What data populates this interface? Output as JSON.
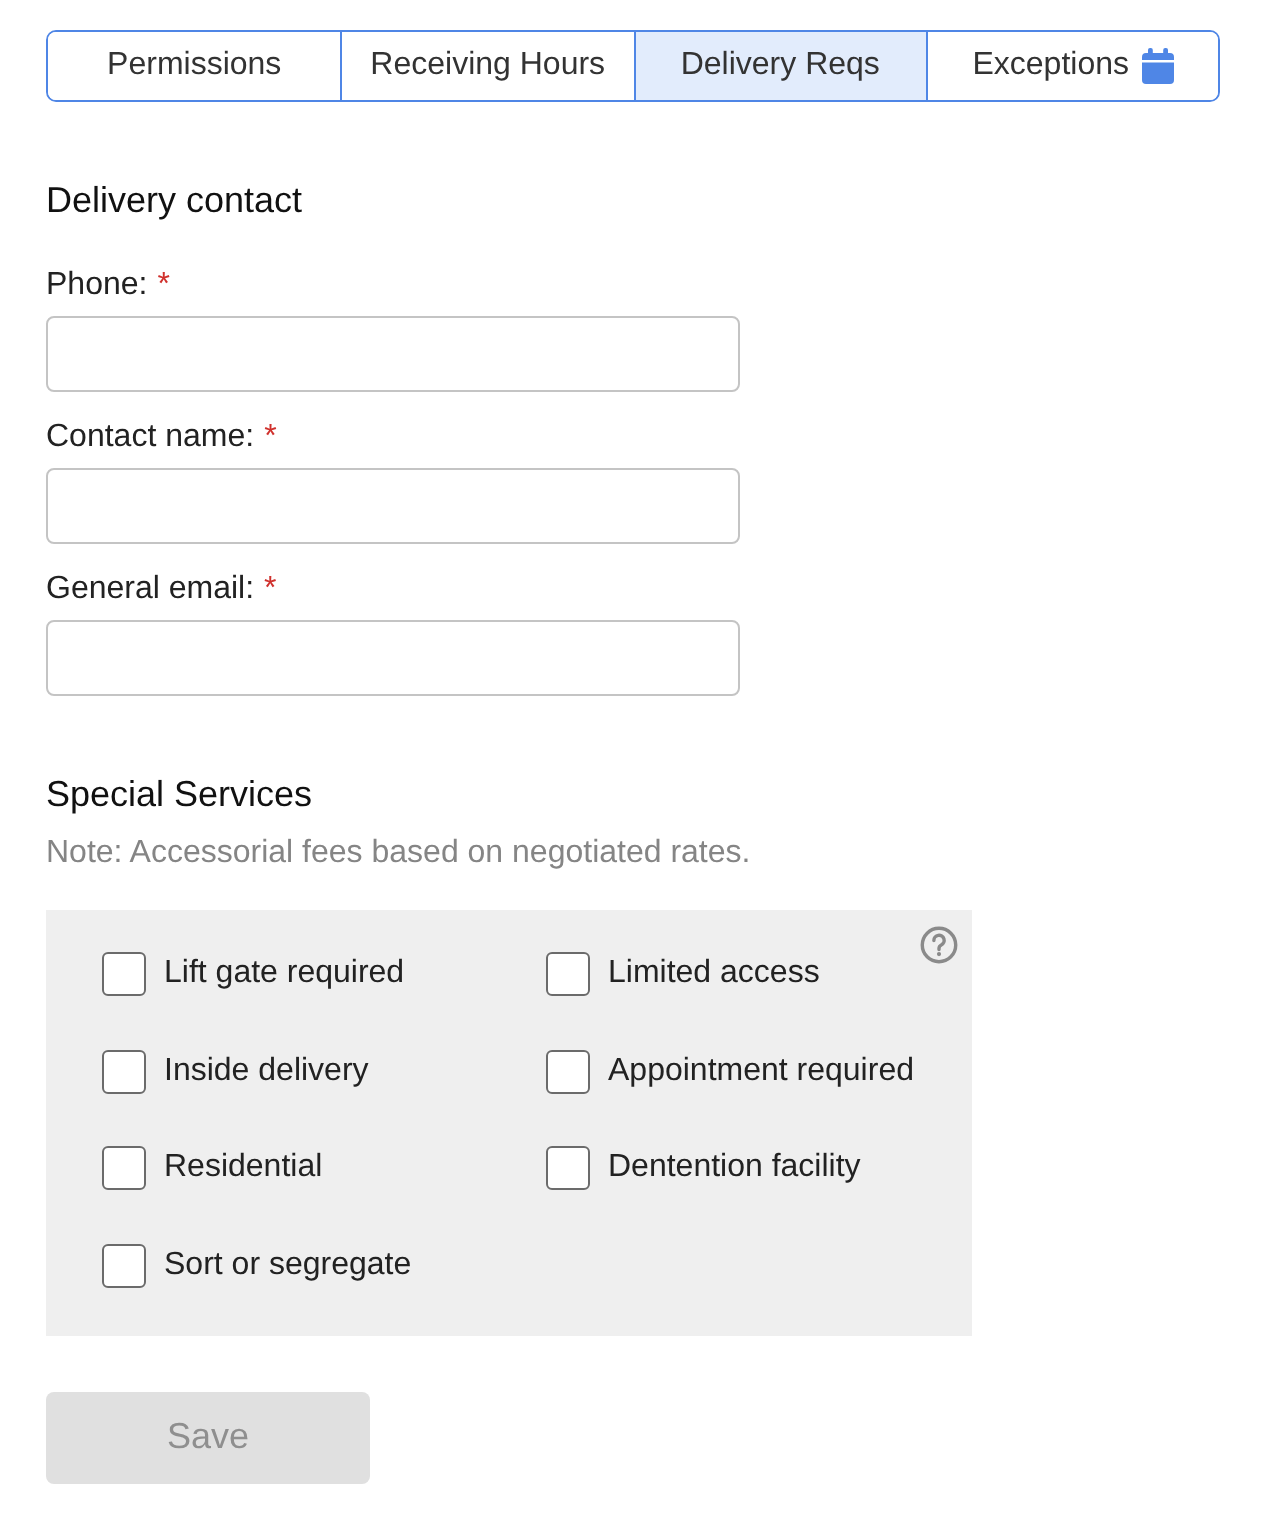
{
  "tabs": [
    {
      "label": "Permissions",
      "selected": false,
      "kind": "text"
    },
    {
      "label": "Receiving Hours",
      "selected": false,
      "kind": "text"
    },
    {
      "label": "Delivery Reqs",
      "selected": true,
      "kind": "text"
    },
    {
      "label": "Exceptions",
      "selected": false,
      "kind": "text-icon"
    }
  ],
  "delivery_contact": {
    "heading": "Delivery contact",
    "fields": [
      {
        "label": "Phone:",
        "required_mark": "*"
      },
      {
        "label": "Contact name:",
        "required_mark": "*"
      },
      {
        "label": "General email:",
        "required_mark": "*"
      }
    ]
  },
  "special_services": {
    "heading": "Special Services",
    "note": "Note: Accessorial fees based on negotiated rates.",
    "options": [
      {
        "label": "Lift gate required",
        "checked": false
      },
      {
        "label": "Limited access",
        "checked": false
      },
      {
        "label": "Inside delivery",
        "checked": false
      },
      {
        "label": "Appointment required",
        "checked": false
      },
      {
        "label": "Residential",
        "checked": false
      },
      {
        "label": "Dentention facility",
        "checked": false
      },
      {
        "label": "Sort or segregate",
        "checked": false
      }
    ]
  },
  "save_button": {
    "label": "Save",
    "disabled": true
  }
}
